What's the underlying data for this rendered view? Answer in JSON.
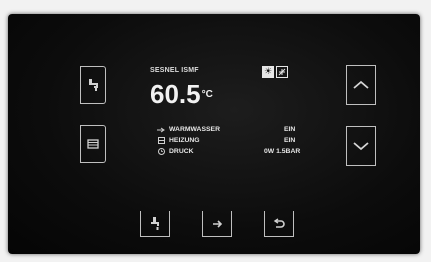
{
  "status": {
    "title": "SESNEL ISMF",
    "temperature": "60.5",
    "temperature_unit": "°C",
    "mode_icons": [
      "sun-icon",
      "snowflake-icon"
    ]
  },
  "parameters": [
    {
      "icon": "water-drop-icon",
      "label": "WARMWASSER",
      "value": "EIN"
    },
    {
      "icon": "grid-icon",
      "label": "HEIZUNG",
      "value": "EIN"
    },
    {
      "icon": "clock-icon",
      "label": "DRUCK",
      "value": "0W 1.5BAR"
    }
  ],
  "buttons": {
    "left": [
      "tap-icon",
      "radiator-icon"
    ],
    "right": [
      "chevron-up-icon",
      "chevron-down-icon"
    ],
    "bottom": [
      "faucet-icon",
      "minus-icon",
      "back-arrow-icon"
    ]
  },
  "colors": {
    "panel": "#0c0c0c",
    "outline": "#bfbfbf",
    "text": "#e6e6e6"
  }
}
